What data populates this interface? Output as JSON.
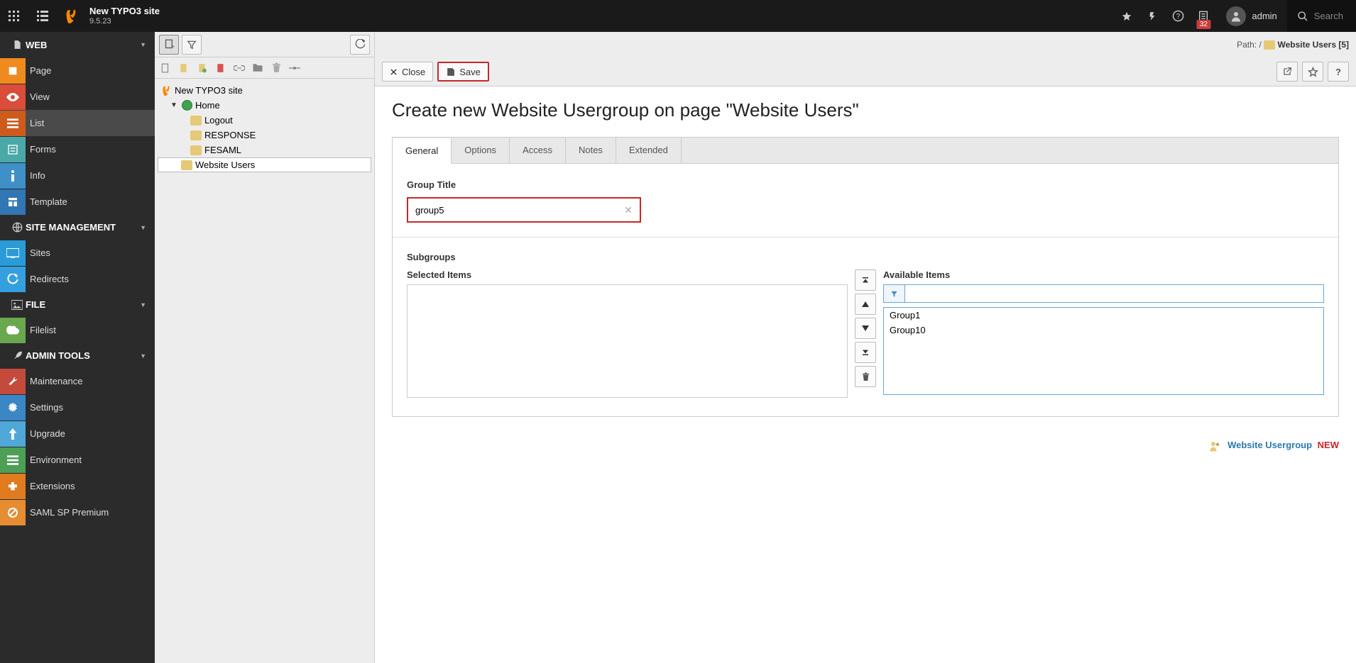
{
  "topbar": {
    "site_title": "New TYPO3 site",
    "site_version": "9.5.23",
    "scheduler_badge": "32",
    "user_name": "admin",
    "search_placeholder": "Search"
  },
  "module_menu": {
    "sections": [
      {
        "label": "WEB",
        "items": [
          {
            "label": "Page"
          },
          {
            "label": "View"
          },
          {
            "label": "List",
            "active": true
          },
          {
            "label": "Forms"
          },
          {
            "label": "Info"
          },
          {
            "label": "Template"
          }
        ]
      },
      {
        "label": "SITE MANAGEMENT",
        "items": [
          {
            "label": "Sites"
          },
          {
            "label": "Redirects"
          }
        ]
      },
      {
        "label": "FILE",
        "items": [
          {
            "label": "Filelist"
          }
        ]
      },
      {
        "label": "ADMIN TOOLS",
        "items": [
          {
            "label": "Maintenance"
          },
          {
            "label": "Settings"
          },
          {
            "label": "Upgrade"
          },
          {
            "label": "Environment"
          },
          {
            "label": "Extensions"
          },
          {
            "label": "SAML SP Premium"
          }
        ]
      }
    ]
  },
  "page_tree": {
    "root": "New TYPO3 site",
    "home": "Home",
    "children": [
      {
        "label": "Logout"
      },
      {
        "label": "RESPONSE"
      },
      {
        "label": "FESAML"
      },
      {
        "label": "Website Users",
        "selected": true
      }
    ]
  },
  "docheader": {
    "path_label": "Path:",
    "path_sep": "/",
    "path_page": "Website Users [5]",
    "close_label": "Close",
    "save_label": "Save"
  },
  "form": {
    "title": "Create new Website Usergroup on page \"Website Users\"",
    "tabs": [
      {
        "label": "General",
        "active": true
      },
      {
        "label": "Options"
      },
      {
        "label": "Access"
      },
      {
        "label": "Notes"
      },
      {
        "label": "Extended"
      }
    ],
    "group_title_label": "Group Title",
    "group_title_value": "group5",
    "subgroups_label": "Subgroups",
    "selected_items_label": "Selected Items",
    "available_items_label": "Available Items",
    "available_items": [
      "Group1",
      "Group10"
    ]
  },
  "footer": {
    "link_text": "Website Usergroup",
    "new_label": "NEW"
  }
}
